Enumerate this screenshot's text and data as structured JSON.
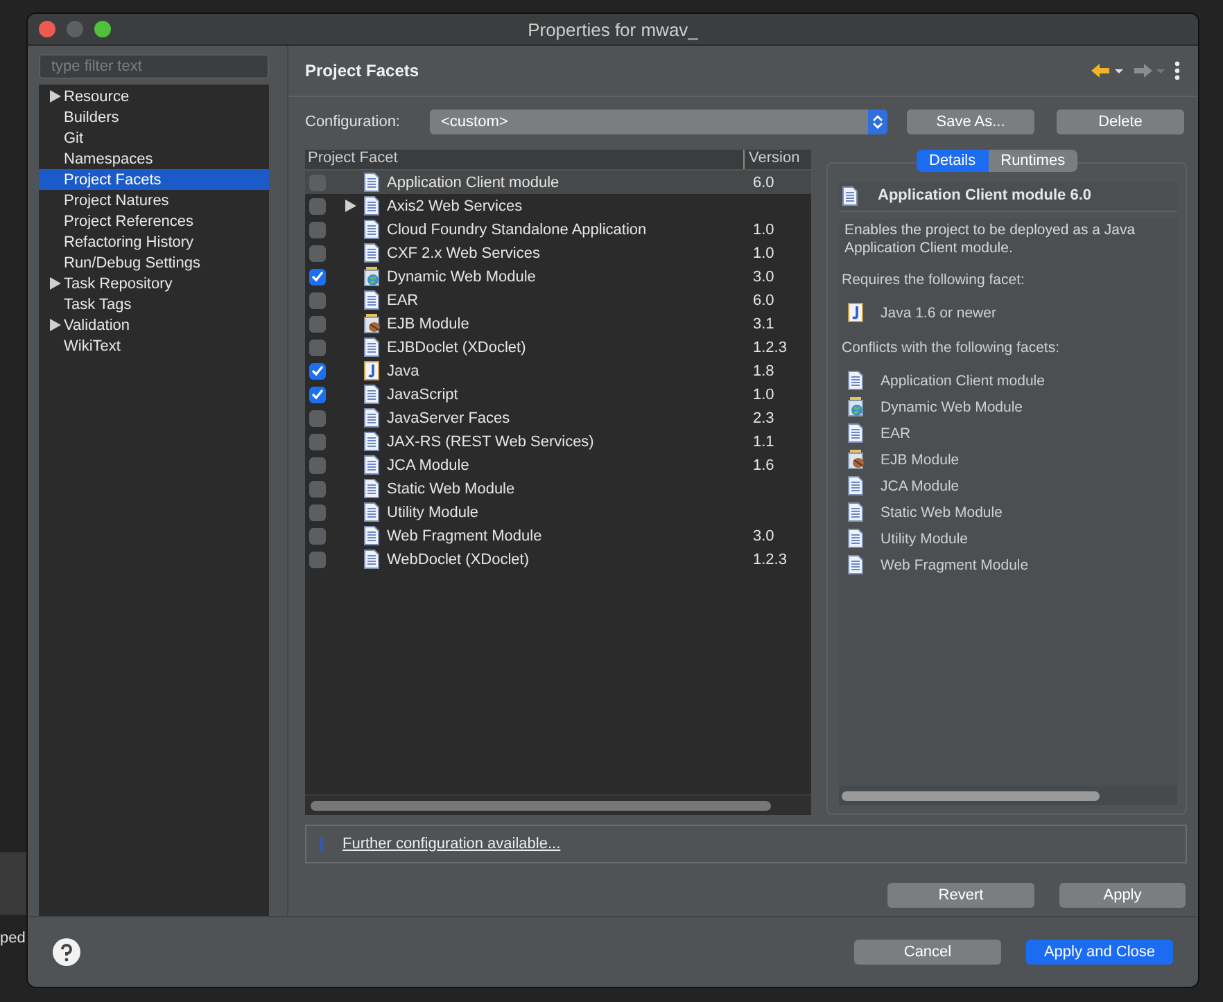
{
  "background": {
    "fragment": "ped"
  },
  "window": {
    "title": "Properties for mwav_"
  },
  "sidebar": {
    "filter": {
      "placeholder": "type filter text"
    },
    "items": [
      {
        "label": "Resource",
        "expandable": true,
        "selected": false
      },
      {
        "label": "Builders",
        "expandable": false,
        "selected": false
      },
      {
        "label": "Git",
        "expandable": false,
        "selected": false
      },
      {
        "label": "Namespaces",
        "expandable": false,
        "selected": false
      },
      {
        "label": "Project Facets",
        "expandable": false,
        "selected": true
      },
      {
        "label": "Project Natures",
        "expandable": false,
        "selected": false
      },
      {
        "label": "Project References",
        "expandable": false,
        "selected": false
      },
      {
        "label": "Refactoring History",
        "expandable": false,
        "selected": false
      },
      {
        "label": "Run/Debug Settings",
        "expandable": false,
        "selected": false
      },
      {
        "label": "Task Repository",
        "expandable": true,
        "selected": false
      },
      {
        "label": "Task Tags",
        "expandable": false,
        "selected": false
      },
      {
        "label": "Validation",
        "expandable": true,
        "selected": false
      },
      {
        "label": "WikiText",
        "expandable": false,
        "selected": false
      }
    ]
  },
  "page": {
    "title": "Project Facets",
    "configuration": {
      "label": "Configuration:",
      "value": "<custom>",
      "buttons": [
        "Save As...",
        "Delete"
      ]
    },
    "table": {
      "columns": [
        "Project Facet",
        "Version"
      ],
      "rows": [
        {
          "name": "Application Client module",
          "version": "6.0",
          "checked": false,
          "selected": true,
          "expandable": false,
          "kind": "document"
        },
        {
          "name": "Axis2 Web Services",
          "checked": false,
          "selected": false,
          "expandable": true,
          "kind": "document"
        },
        {
          "name": "Cloud Foundry Standalone Application",
          "version": "1.0",
          "checked": false,
          "selected": false,
          "expandable": false,
          "kind": "document"
        },
        {
          "name": "CXF 2.x Web Services",
          "version": "1.0",
          "checked": false,
          "selected": false,
          "expandable": false,
          "kind": "document"
        },
        {
          "name": "Dynamic Web Module",
          "version": "3.0",
          "checked": true,
          "selected": false,
          "expandable": false,
          "kind": "web"
        },
        {
          "name": "EAR",
          "version": "6.0",
          "checked": false,
          "selected": false,
          "expandable": false,
          "kind": "document"
        },
        {
          "name": "EJB Module",
          "version": "3.1",
          "checked": false,
          "selected": false,
          "expandable": false,
          "kind": "bean"
        },
        {
          "name": "EJBDoclet (XDoclet)",
          "version": "1.2.3",
          "checked": false,
          "selected": false,
          "expandable": false,
          "kind": "document"
        },
        {
          "name": "Java",
          "version": "1.8",
          "checked": true,
          "selected": false,
          "expandable": false,
          "kind": "java"
        },
        {
          "name": "JavaScript",
          "version": "1.0",
          "checked": true,
          "selected": false,
          "expandable": false,
          "kind": "document"
        },
        {
          "name": "JavaServer Faces",
          "version": "2.3",
          "checked": false,
          "selected": false,
          "expandable": false,
          "kind": "document"
        },
        {
          "name": "JAX-RS (REST Web Services)",
          "version": "1.1",
          "checked": false,
          "selected": false,
          "expandable": false,
          "kind": "document"
        },
        {
          "name": "JCA Module",
          "version": "1.6",
          "checked": false,
          "selected": false,
          "expandable": false,
          "kind": "document"
        },
        {
          "name": "Static Web Module",
          "checked": false,
          "selected": false,
          "expandable": false,
          "kind": "document"
        },
        {
          "name": "Utility Module",
          "checked": false,
          "selected": false,
          "expandable": false,
          "kind": "document"
        },
        {
          "name": "Web Fragment Module",
          "version": "3.0",
          "checked": false,
          "selected": false,
          "expandable": false,
          "kind": "document"
        },
        {
          "name": "WebDoclet (XDoclet)",
          "version": "1.2.3",
          "checked": false,
          "selected": false,
          "expandable": false,
          "kind": "document"
        }
      ]
    },
    "details": {
      "tabs": [
        {
          "label": "Details",
          "selected": true
        },
        {
          "label": "Runtimes",
          "selected": false
        }
      ],
      "heading": {
        "text": "Application Client module 6.0",
        "kind": "document"
      },
      "description": "Enables the project to be deployed as a Java Application Client module.",
      "requires_label": "Requires the following facet:",
      "requires": [
        {
          "name": "Java 1.6 or newer",
          "kind": "java"
        }
      ],
      "conflicts_label": "Conflicts with the following facets:",
      "conflicts": [
        {
          "name": "Application Client module",
          "kind": "document"
        },
        {
          "name": "Dynamic Web Module",
          "kind": "web"
        },
        {
          "name": "EAR",
          "kind": "document"
        },
        {
          "name": "EJB Module",
          "kind": "bean"
        },
        {
          "name": "JCA Module",
          "kind": "document"
        },
        {
          "name": "Static Web Module",
          "kind": "document"
        },
        {
          "name": "Utility Module",
          "kind": "document"
        },
        {
          "name": "Web Fragment Module",
          "kind": "document"
        }
      ]
    },
    "further_link": "Further configuration available...",
    "buttons": [
      "Revert",
      "Apply"
    ]
  },
  "footer": {
    "buttons": [
      {
        "label": "Cancel",
        "primary": false
      },
      {
        "label": "Apply and Close",
        "primary": true
      }
    ]
  }
}
